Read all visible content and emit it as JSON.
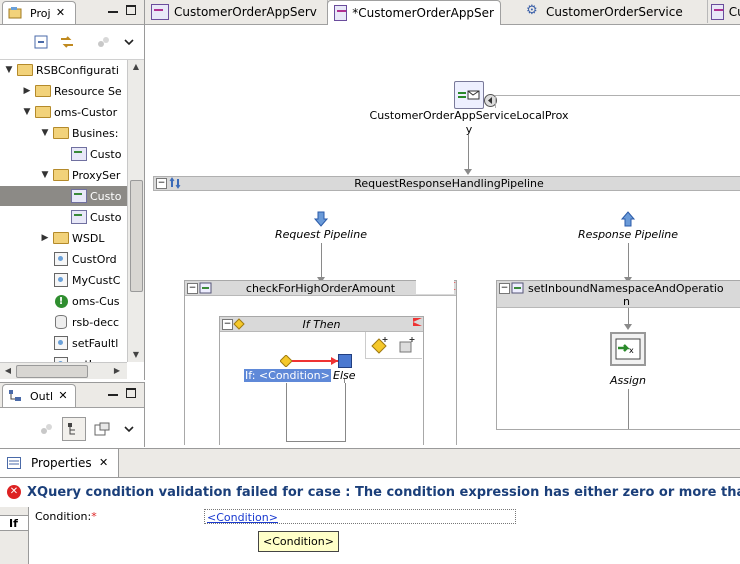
{
  "project_view": {
    "tab_label": "Proj",
    "tree": [
      {
        "label": "RSBConfigurati",
        "twisty": "▼",
        "icon": "folder",
        "indent": 0
      },
      {
        "label": "Resource Se",
        "twisty": "▶",
        "icon": "folder",
        "indent": 1
      },
      {
        "label": "oms-Custor",
        "twisty": "▼",
        "icon": "folder",
        "indent": 1
      },
      {
        "label": "Busines:",
        "twisty": "▼",
        "icon": "folder",
        "indent": 2
      },
      {
        "label": "Custo",
        "twisty": "",
        "icon": "proxy",
        "indent": 3
      },
      {
        "label": "ProxySer",
        "twisty": "▼",
        "icon": "folder",
        "indent": 2
      },
      {
        "label": "Custo",
        "twisty": "",
        "icon": "proxy",
        "indent": 3,
        "selected": true
      },
      {
        "label": "Custo",
        "twisty": "",
        "icon": "proxy",
        "indent": 3
      },
      {
        "label": "WSDL",
        "twisty": "▶",
        "icon": "folder",
        "indent": 2
      },
      {
        "label": "CustOrd",
        "twisty": "",
        "icon": "xq",
        "indent": 2
      },
      {
        "label": "MyCustC",
        "twisty": "",
        "icon": "xq",
        "indent": 2
      },
      {
        "label": "oms-Cus",
        "twisty": "",
        "icon": "warn",
        "indent": 2
      },
      {
        "label": "rsb-decc",
        "twisty": "",
        "icon": "cyl",
        "indent": 2
      },
      {
        "label": "setFaultl",
        "twisty": "",
        "icon": "xq",
        "indent": 2
      },
      {
        "label": "setIn",
        "twisty": "",
        "icon": "xq",
        "indent": 2
      }
    ]
  },
  "outline_view": {
    "tab_label": "Outl"
  },
  "editor_tabs": [
    {
      "label": "CustomerOrderAppServ",
      "icon": "proxy",
      "active": false
    },
    {
      "label": "*CustomerOrderAppSer",
      "icon": "proxy",
      "active": true
    },
    {
      "label": "CustomerOrderService",
      "icon": "business",
      "active": false
    },
    {
      "label": "Cus",
      "icon": "proxy",
      "active": false
    }
  ],
  "canvas": {
    "proxy_label": "CustomerOrderAppServiceLocalProx",
    "proxy_label_line2": "y",
    "pipeline_title": "RequestResponseHandlingPipeline",
    "request_pipeline": "Request Pipeline",
    "response_pipeline": "Response Pipeline",
    "stage_left": "checkForHighOrderAmount",
    "stage_right_line1": "setInboundNamespaceAndOperatio",
    "stage_right_line2": "n",
    "if_then_title": "If Then",
    "if_condition": "If: <Condition>",
    "else_label": "Else",
    "assign_label": "Assign"
  },
  "properties": {
    "tab_label": "Properties",
    "error_message": "XQuery condition validation failed for case : The condition expression has either zero or more than",
    "side_tab": "If",
    "condition_label": "Condition:",
    "required_marker": "*",
    "condition_value": "<Condition>",
    "tooltip": "<Condition>"
  },
  "colors": {
    "selection": "#8c8a86",
    "error_text": "#1b3f7a",
    "link": "#1a3ad0",
    "flag": "#ee3333",
    "tooltip_bg": "#ffffc8"
  }
}
